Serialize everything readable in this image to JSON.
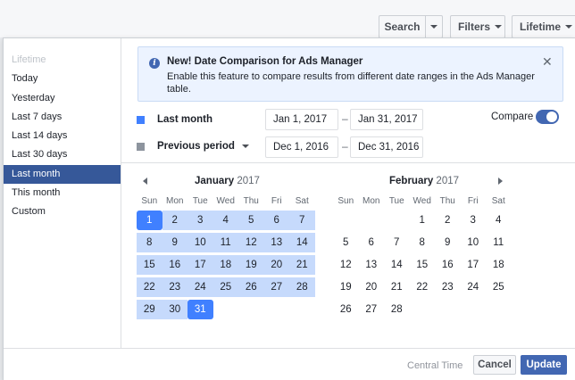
{
  "toolbar": {
    "search_label": "Search",
    "filters_label": "Filters",
    "lifetime_label": "Lifetime"
  },
  "presets": [
    "Lifetime",
    "Today",
    "Yesterday",
    "Last 7 days",
    "Last 14 days",
    "Last 30 days",
    "Last month",
    "This month",
    "Custom"
  ],
  "selected_preset": "Last month",
  "banner": {
    "title": "New! Date Comparison for Ads Manager",
    "text": "Enable this feature to compare results from different date ranges in the Ads Manager table.",
    "close_symbol": "✕"
  },
  "primary_range": {
    "label": "Last month",
    "start": "Jan 1, 2017",
    "end": "Jan 31, 2017",
    "color": "#4080ff"
  },
  "comparison_range": {
    "label": "Previous period",
    "start": "Dec 1, 2016",
    "end": "Dec 31, 2016",
    "color": "#8d949e"
  },
  "range_separator": "–",
  "compare": {
    "label": "Compare",
    "enabled": true
  },
  "calendars": [
    {
      "month": "January",
      "year": "2017",
      "weekdays": [
        "Sun",
        "Mon",
        "Tue",
        "Wed",
        "Thu",
        "Fri",
        "Sat"
      ],
      "weeks": [
        [
          "1",
          "2",
          "3",
          "4",
          "5",
          "6",
          "7"
        ],
        [
          "8",
          "9",
          "10",
          "11",
          "12",
          "13",
          "14"
        ],
        [
          "15",
          "16",
          "17",
          "18",
          "19",
          "20",
          "21"
        ],
        [
          "22",
          "23",
          "24",
          "25",
          "26",
          "27",
          "28"
        ],
        [
          "29",
          "30",
          "31",
          "",
          "",
          "",
          ""
        ]
      ],
      "highlight_range": true
    },
    {
      "month": "February",
      "year": "2017",
      "weekdays": [
        "Sun",
        "Mon",
        "Tue",
        "Wed",
        "Thu",
        "Fri",
        "Sat"
      ],
      "weeks": [
        [
          "",
          "",
          "",
          "1",
          "2",
          "3",
          "4"
        ],
        [
          "5",
          "6",
          "7",
          "8",
          "9",
          "10",
          "11"
        ],
        [
          "12",
          "13",
          "14",
          "15",
          "16",
          "17",
          "18"
        ],
        [
          "19",
          "20",
          "21",
          "22",
          "23",
          "24",
          "25"
        ],
        [
          "26",
          "27",
          "28",
          "",
          "",
          "",
          ""
        ]
      ],
      "highlight_range": false
    }
  ],
  "footer": {
    "timezone": "Central Time",
    "cancel_label": "Cancel",
    "update_label": "Update"
  },
  "colors": {
    "accent": "#4267b2",
    "selected_day": "#4080ff",
    "range_fill": "#c6dafc",
    "selected_preset_bg": "#365899"
  }
}
